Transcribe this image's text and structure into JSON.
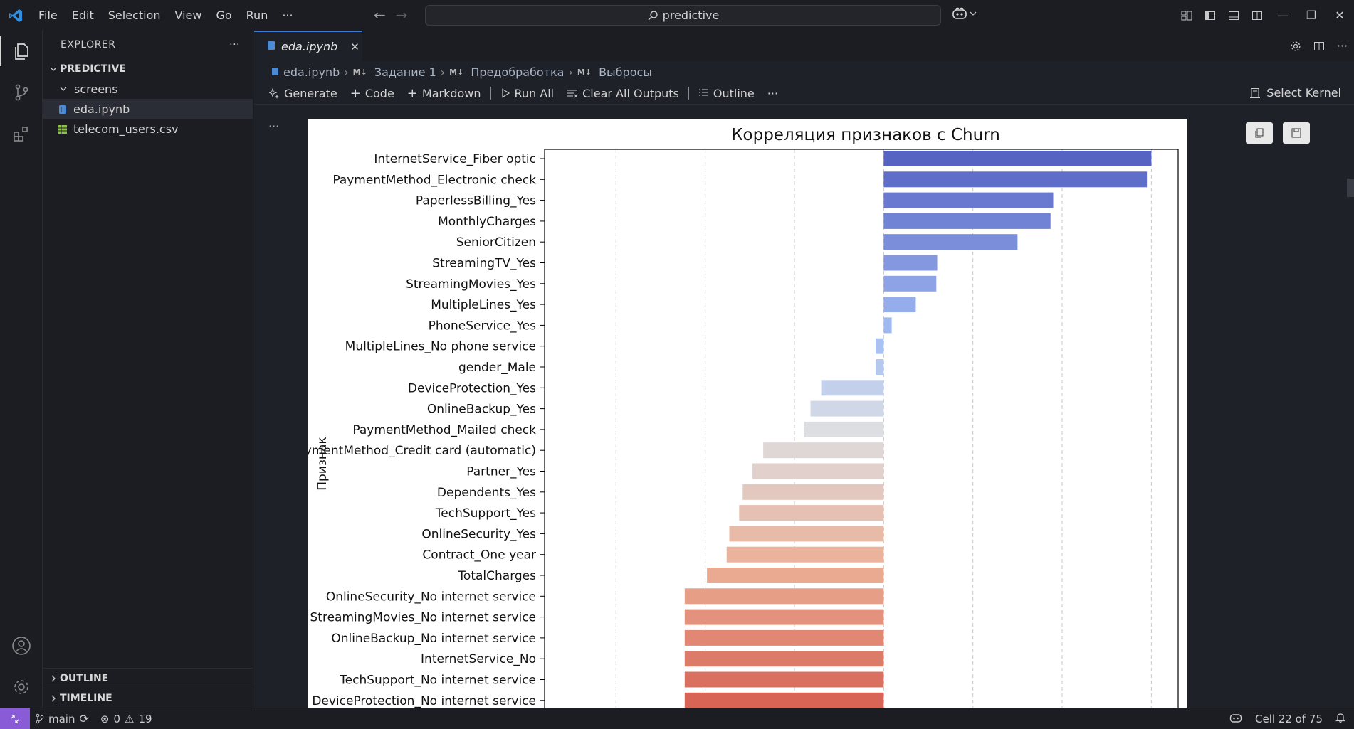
{
  "menu": [
    "File",
    "Edit",
    "Selection",
    "View",
    "Go",
    "Run",
    "···"
  ],
  "search": {
    "text": "predictive"
  },
  "sidebar": {
    "title": "EXPLORER",
    "more": "···",
    "project": "PREDICTIVE",
    "items": [
      {
        "label": "screens",
        "kind": "folder"
      },
      {
        "label": "eda.ipynb",
        "kind": "notebook"
      },
      {
        "label": "telecom_users.csv",
        "kind": "csv"
      }
    ],
    "outline": "OUTLINE",
    "timeline": "TIMELINE"
  },
  "editor": {
    "tab_label": "eda.ipynb",
    "breadcrumb": [
      "eda.ipynb",
      "Задание 1",
      "Предобработка",
      "Выбросы"
    ],
    "md_tag": "M↓",
    "toolbar": {
      "generate": "Generate",
      "code": "Code",
      "markdown": "Markdown",
      "run_all": "Run All",
      "clear": "Clear All Outputs",
      "outline": "Outline",
      "more": "···",
      "kernel": "Select Kernel"
    },
    "cell_more": "···"
  },
  "status": {
    "branch": "main",
    "errors": "0",
    "warnings": "19",
    "cell": "Cell 22 of 75"
  },
  "colors": {
    "accent": "#3b7bd6",
    "remote": "#8a5bd6",
    "background": "#1b1d23"
  },
  "chart_data": {
    "type": "bar",
    "orientation": "horizontal",
    "title": "Корреляция признаков с Churn",
    "ylabel": "Признак",
    "xlabel": "",
    "xlim": [
      -0.38,
      0.33
    ],
    "grid": "x, dashed",
    "categories": [
      "InternetService_Fiber optic",
      "PaymentMethod_Electronic check",
      "PaperlessBilling_Yes",
      "MonthlyCharges",
      "SeniorCitizen",
      "StreamingTV_Yes",
      "StreamingMovies_Yes",
      "MultipleLines_Yes",
      "PhoneService_Yes",
      "MultipleLines_No phone service",
      "gender_Male",
      "DeviceProtection_Yes",
      "OnlineBackup_Yes",
      "PaymentMethod_Mailed check",
      "PaymentMethod_Credit card (automatic)",
      "Partner_Yes",
      "Dependents_Yes",
      "TechSupport_Yes",
      "OnlineSecurity_Yes",
      "Contract_One year",
      "TotalCharges",
      "OnlineSecurity_No internet service",
      "StreamingMovies_No internet service",
      "OnlineBackup_No internet service",
      "InternetService_No",
      "TechSupport_No internet service",
      "DeviceProtection_No internet service"
    ],
    "values": [
      0.3,
      0.295,
      0.19,
      0.187,
      0.15,
      0.06,
      0.059,
      0.036,
      0.009,
      -0.009,
      -0.009,
      -0.07,
      -0.082,
      -0.089,
      -0.135,
      -0.147,
      -0.158,
      -0.162,
      -0.173,
      -0.176,
      -0.198,
      -0.223,
      -0.223,
      -0.223,
      -0.223,
      -0.223,
      -0.223
    ]
  }
}
